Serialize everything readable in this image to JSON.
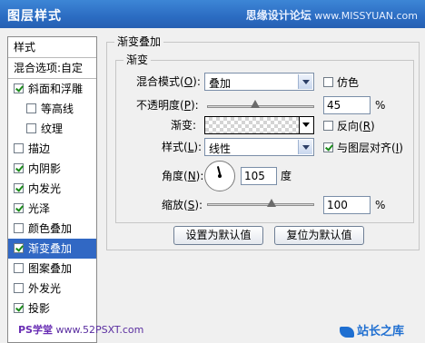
{
  "window": {
    "title": "图层样式",
    "watermark_cn": "思缘设计论坛",
    "watermark_url": "www.MISSYUAN.com"
  },
  "sidebar": {
    "header": "样式",
    "blend_options": "混合选项:自定",
    "items": [
      {
        "label": "斜面和浮雕",
        "checked": true,
        "sub": false,
        "selected": false
      },
      {
        "label": "等高线",
        "checked": false,
        "sub": true,
        "selected": false
      },
      {
        "label": "纹理",
        "checked": false,
        "sub": true,
        "selected": false
      },
      {
        "label": "描边",
        "checked": false,
        "sub": false,
        "selected": false
      },
      {
        "label": "内阴影",
        "checked": true,
        "sub": false,
        "selected": false
      },
      {
        "label": "内发光",
        "checked": true,
        "sub": false,
        "selected": false
      },
      {
        "label": "光泽",
        "checked": true,
        "sub": false,
        "selected": false
      },
      {
        "label": "颜色叠加",
        "checked": false,
        "sub": false,
        "selected": false
      },
      {
        "label": "渐变叠加",
        "checked": true,
        "sub": false,
        "selected": true
      },
      {
        "label": "图案叠加",
        "checked": false,
        "sub": false,
        "selected": false
      },
      {
        "label": "外发光",
        "checked": false,
        "sub": false,
        "selected": false
      },
      {
        "label": "投影",
        "checked": true,
        "sub": false,
        "selected": false
      }
    ]
  },
  "panel": {
    "outer_legend": "渐变叠加",
    "inner_legend": "渐变",
    "blend_mode": {
      "label": "混合模式(",
      "key": "O",
      "tail": "):",
      "value": "叠加"
    },
    "dither": {
      "label": "仿色",
      "checked": false
    },
    "opacity": {
      "label": "不透明度(",
      "key": "P",
      "tail": "):",
      "value": "45",
      "unit": "%",
      "level": 0.45
    },
    "gradient": {
      "label": "渐变:"
    },
    "reverse": {
      "label": "反向(",
      "key": "R",
      "tail": ")",
      "checked": false
    },
    "style": {
      "label": "样式(",
      "key": "L",
      "tail": "):",
      "value": "线性"
    },
    "align": {
      "label": "与图层对齐(",
      "key": "I",
      "tail": ")",
      "checked": true
    },
    "angle": {
      "label": "角度(",
      "key": "N",
      "tail": "):",
      "value": "105",
      "unit": "度"
    },
    "scale": {
      "label": "缩放(",
      "key": "S",
      "tail": "):",
      "value": "100",
      "unit": "%",
      "level": 1.0
    },
    "buttons": {
      "set_default": "设置为默认值",
      "reset_default": "复位为默认值"
    }
  },
  "footer": {
    "left_prefix": "PS学堂",
    "left_url": "www.52PSXT.com",
    "right": "站长之库"
  },
  "colors": {
    "titlebar": "#2b6cc2",
    "selection": "#3168c4"
  }
}
